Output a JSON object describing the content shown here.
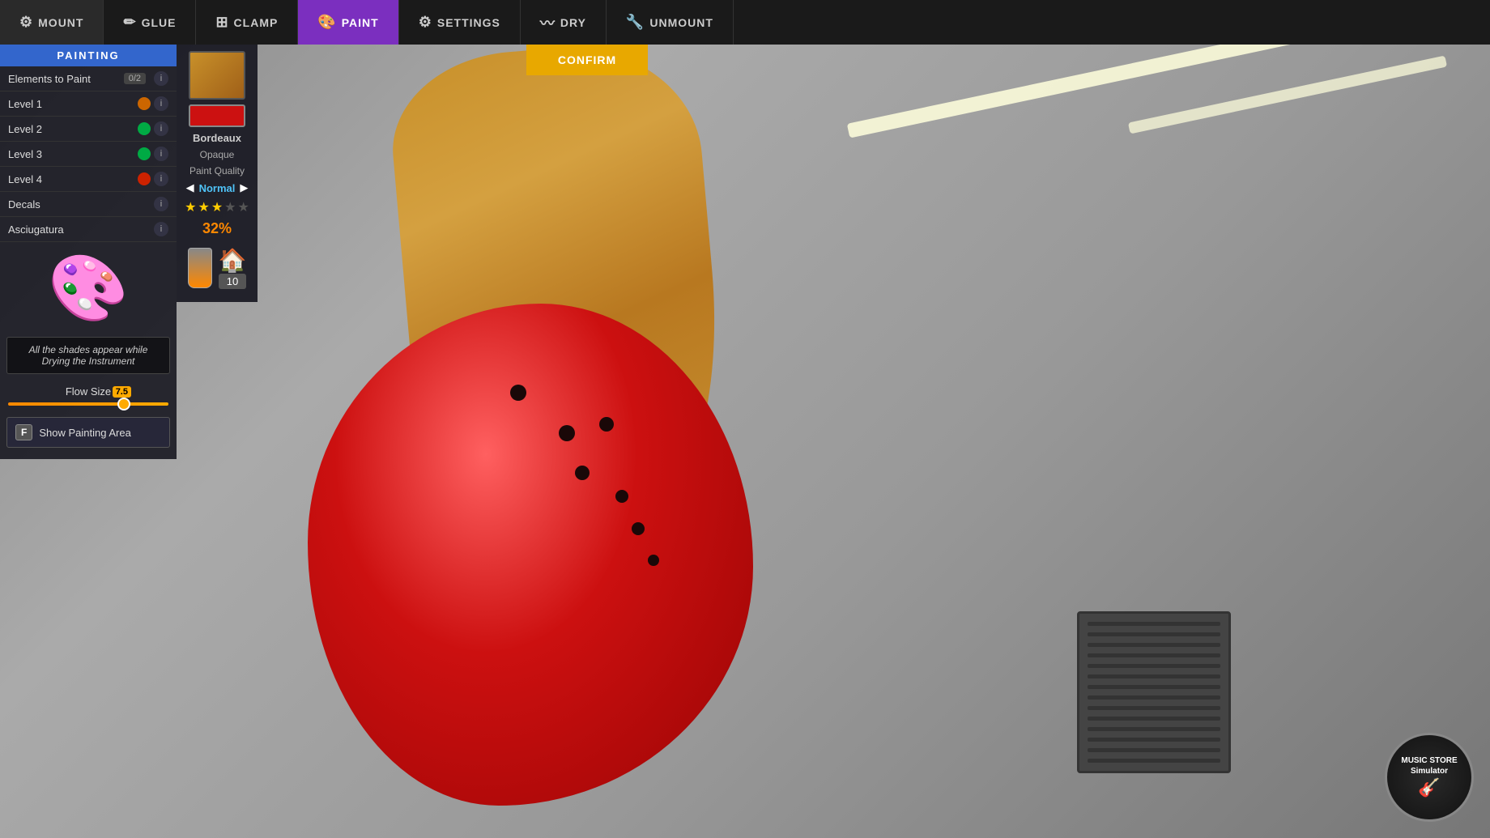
{
  "topbar": {
    "items": [
      {
        "id": "mount",
        "label": "MOUNT",
        "icon": "⚙"
      },
      {
        "id": "glue",
        "label": "GLUE",
        "icon": "✏"
      },
      {
        "id": "clamp",
        "label": "CLAMP",
        "icon": "⊞"
      },
      {
        "id": "paint",
        "label": "PAINT",
        "icon": "🎨",
        "active": true
      },
      {
        "id": "settings",
        "label": "SETTINGS",
        "icon": "⚙"
      },
      {
        "id": "dry",
        "label": "DRY",
        "icon": "〰"
      },
      {
        "id": "unmount",
        "label": "UNMOUNT",
        "icon": "🔧"
      }
    ],
    "confirm_label": "CONFIRM"
  },
  "left_panel": {
    "title": "PAINTING",
    "rows": [
      {
        "label": "Elements to Paint",
        "badge": "0/2",
        "icon": "info"
      },
      {
        "label": "Level 1",
        "icon_type": "orange",
        "has_info": true
      },
      {
        "label": "Level 2",
        "icon_type": "green",
        "has_info": true
      },
      {
        "label": "Level 3",
        "icon_type": "green",
        "has_info": true
      },
      {
        "label": "Level 4",
        "icon_type": "red",
        "has_info": true
      },
      {
        "label": "Decals",
        "has_info": true
      },
      {
        "label": "Asciugatura",
        "has_info": true
      }
    ],
    "info_text": "All the shades appear while Drying the Instrument",
    "flow_size_label": "Flow Size",
    "flow_value": "7.5",
    "show_painting_area_label": "Show Painting Area",
    "key_f": "F"
  },
  "color_panel": {
    "color_name": "Bordeaux",
    "color_type": "Opaque",
    "quality_label": "Paint Quality",
    "quality_value": "Normal",
    "stars_filled": 3,
    "stars_total": 5,
    "percent": "32%",
    "count": "10"
  },
  "logo": {
    "line1": "MUSIC STORE",
    "line2": "Simulator"
  }
}
